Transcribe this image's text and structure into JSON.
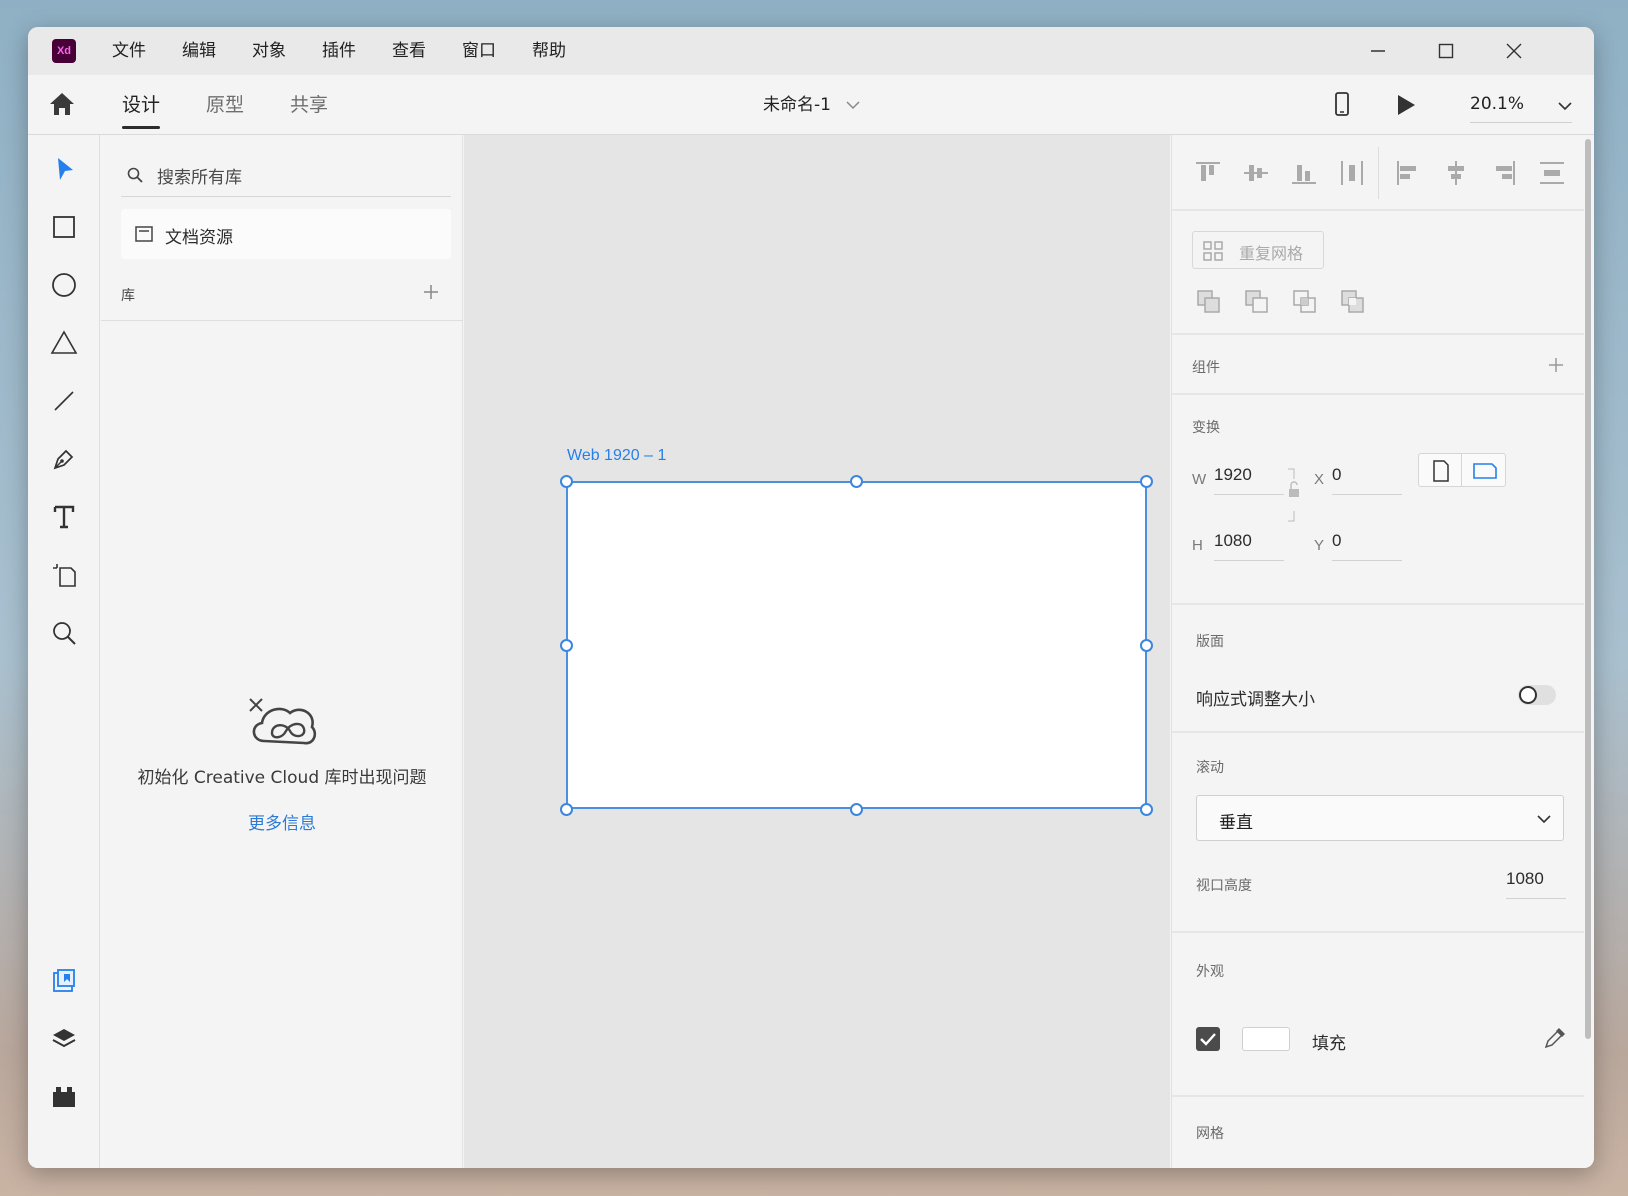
{
  "app": {
    "logo": "Xd",
    "brand_color": "#470137",
    "accent": "#2680eb"
  },
  "menu": [
    "文件",
    "编辑",
    "对象",
    "插件",
    "查看",
    "窗口",
    "帮助"
  ],
  "tabs": [
    {
      "label": "设计",
      "active": true
    },
    {
      "label": "原型",
      "active": false
    },
    {
      "label": "共享",
      "active": false
    }
  ],
  "document": {
    "title": "未命名-1"
  },
  "zoom": {
    "value": "20.1%"
  },
  "library": {
    "search_placeholder": "搜索所有库",
    "doc_assets": "文档资源",
    "section_label": "库",
    "error_message": "初始化 Creative Cloud 库时出现问题",
    "more_info": "更多信息"
  },
  "canvas": {
    "artboard_name": "Web 1920 – 1"
  },
  "props": {
    "repeat_grid": "重复网格",
    "components_label": "组件",
    "transform_label": "变换",
    "w_label": "W",
    "w_value": "1920",
    "h_label": "H",
    "h_value": "1080",
    "x_label": "X",
    "x_value": "0",
    "y_label": "Y",
    "y_value": "0",
    "layout_label": "版面",
    "responsive_label": "响应式调整大小",
    "responsive_on": false,
    "scroll_label": "滚动",
    "scroll_value": "垂直",
    "viewport_label": "视口高度",
    "viewport_value": "1080",
    "appearance_label": "外观",
    "fill_label": "填充",
    "fill_checked": true,
    "fill_color": "#ffffff",
    "grid_label": "网格"
  }
}
